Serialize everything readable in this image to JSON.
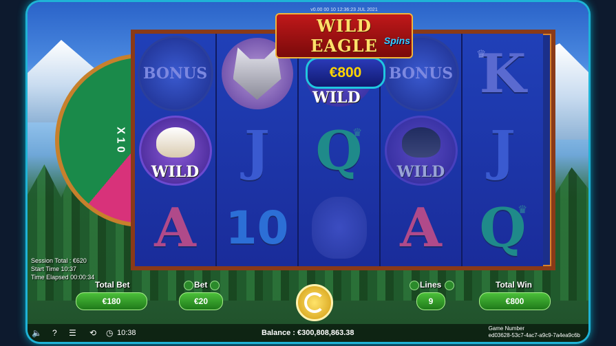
{
  "game": {
    "logo_small_text": "v0.00 00 10 12:36:23 JUL 2021",
    "logo_title": "WILD EAGLE",
    "logo_subtitle": "Spins",
    "wheel_text": "X 1 0"
  },
  "reels": {
    "col1": [
      "BONUS",
      "WILD",
      "A"
    ],
    "col2": [
      "",
      "J",
      "10"
    ],
    "col3": [
      "WILD",
      "Q",
      ""
    ],
    "col4": [
      "BONUS",
      "WILD",
      "A"
    ],
    "col5": [
      "K",
      "J",
      "Q"
    ]
  },
  "prize": {
    "value": "€800",
    "label": "WILD"
  },
  "session": {
    "total": "Session Total : €620",
    "start": "Start Time 10:37",
    "elapsed": "Time Elapsed 00:00:34"
  },
  "controls": {
    "total_bet_label": "Total Bet",
    "total_bet_value": "€180",
    "bet_label": "Bet",
    "bet_value": "€20",
    "lines_label": "Lines",
    "lines_value": "9",
    "total_win_label": "Total Win",
    "total_win_value": "€800"
  },
  "bottom": {
    "time": "10:38",
    "balance": "Balance : €300,808,863.38",
    "game_number_label": "Game Number",
    "game_number": "ed03628-53c7-4ac7-a9c9-7a4ea9c6b"
  }
}
